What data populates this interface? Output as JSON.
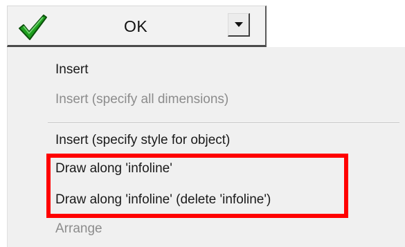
{
  "ok_button": {
    "label": "OK",
    "icon": "check-icon",
    "dropdown_icon": "chevron-down-icon"
  },
  "menu": {
    "items": [
      {
        "label": "Insert",
        "enabled": true
      },
      {
        "label": "Insert (specify all dimensions)",
        "enabled": false
      },
      {
        "label": "Insert (specify style for object)",
        "enabled": true
      },
      {
        "label": "Draw along 'infoline'",
        "enabled": true,
        "highlighted": true
      },
      {
        "label": "Draw along 'infoline' (delete 'infoline')",
        "enabled": true,
        "highlighted": true
      },
      {
        "label": "Arrange",
        "enabled": false
      }
    ]
  },
  "colors": {
    "check_green": "#1e9e1e",
    "highlight_red": "#ff0000",
    "menu_background": "#f0f0f0",
    "disabled_text": "#8c8c8c"
  }
}
